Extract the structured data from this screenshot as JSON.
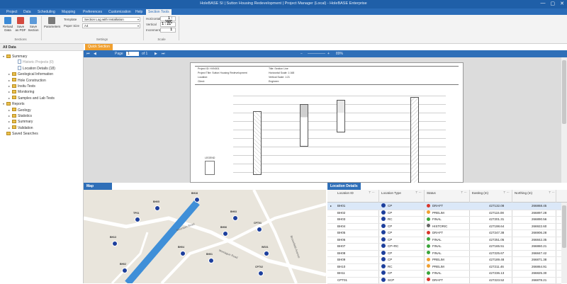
{
  "window": {
    "title": "HoleBASE SI | Sutton Housing Redevelopment | Project Manager (Local) - HoleBASE Enterprise",
    "controls": [
      "—",
      "▢",
      "✕"
    ]
  },
  "ribbon_tabs": [
    "Project",
    "Data",
    "Scheduling",
    "Mapping",
    "Preferences",
    "Customization",
    "Help",
    "Section Tools"
  ],
  "ribbon": {
    "buttons": [
      "Reload Data",
      "Save as PDF",
      "Save Section",
      "Parameters"
    ],
    "group_sections": "Sections",
    "template_label": "Template",
    "template_value": "Section Log with Installation",
    "paper_label": "Paper Size",
    "paper_value": "A4",
    "group_settings": "Settings",
    "horizontal_label": "Horizontal",
    "horizontal_value": "1 : 168*",
    "vertical_label": "Vertical",
    "vertical_value": "1 : 21*",
    "incremental_label": "Incremental",
    "incremental_value": "1",
    "group_scale": "Scale"
  },
  "tree": {
    "header": "All Data",
    "nodes": [
      {
        "label": "Summary",
        "type": "folder",
        "toggle": "▾",
        "level": 0
      },
      {
        "label": "Historic Projects (0)",
        "type": "doc",
        "toggle": "",
        "level": 2,
        "dim": true
      },
      {
        "label": "Location Details (18)",
        "type": "doc",
        "toggle": "",
        "level": 2
      },
      {
        "label": "Geological Information",
        "type": "folder",
        "toggle": "▸",
        "level": 1
      },
      {
        "label": "Hole Construction",
        "type": "folder",
        "toggle": "▸",
        "level": 1
      },
      {
        "label": "Insitu Tests",
        "type": "folder",
        "toggle": "▸",
        "level": 1
      },
      {
        "label": "Monitoring",
        "type": "folder",
        "toggle": "▸",
        "level": 1
      },
      {
        "label": "Samples and Lab Tests",
        "type": "folder",
        "toggle": "▸",
        "level": 1
      },
      {
        "label": "Reports",
        "type": "folder",
        "toggle": "▾",
        "level": 0
      },
      {
        "label": "Geology",
        "type": "folder",
        "toggle": "▸",
        "level": 1
      },
      {
        "label": "Statistics",
        "type": "folder",
        "toggle": "▸",
        "level": 1
      },
      {
        "label": "Summary",
        "type": "folder",
        "toggle": "▸",
        "level": 1
      },
      {
        "label": "Validation",
        "type": "folder",
        "toggle": "▸",
        "level": 1
      },
      {
        "label": "Saved Searches",
        "type": "folder",
        "toggle": "",
        "level": 0
      }
    ]
  },
  "viewer": {
    "tab": "Quick Section",
    "page_label": "Page",
    "page_value": "1",
    "page_of": "of 1",
    "zoom": "89%",
    "zoom_out": "−",
    "zoom_in": "+",
    "nav": [
      "⏮",
      "◀",
      "▶",
      "⏭"
    ],
    "sheet": {
      "project_id": "Project ID: HVN001",
      "project_title": "Project Title: Sutton Housing Redevelopment",
      "location": "Location:",
      "client": "Client:",
      "title": "Title: Section Line",
      "horiz_scale": "Horizontal Scale: 1:168",
      "vert_scale": "Vertical Scale: 1:21",
      "engineer": "Engineer:",
      "legend": "LEGEND"
    }
  },
  "map": {
    "header": "Map",
    "road_labels": [
      "Mountain Road",
      "Montague Road",
      "Broomfield Avenue"
    ],
    "boreholes": [
      "BH18",
      "BH05",
      "BH03",
      "CPT01",
      "BH06",
      "BH04",
      "TP01",
      "BH01",
      "BH02",
      "CPT02",
      "WS01",
      "BH13"
    ]
  },
  "location_details": {
    "header": "Location Details",
    "columns": [
      "Location ID",
      "Location Type",
      "Status",
      "Easting (m)",
      "Northing (m)"
    ],
    "filter_icons": "⊤ ⋯",
    "rows": [
      {
        "id": "BH01",
        "type": "CP",
        "status": "DRAFT",
        "status_color": "#d9352b",
        "easting": "427132.08",
        "northing": "266868.45"
      },
      {
        "id": "BH02",
        "type": "CP",
        "status": "PRELIM",
        "status_color": "#f0a030",
        "easting": "427115.08",
        "northing": "266897.28"
      },
      {
        "id": "BH03",
        "type": "RC",
        "status": "FINAL",
        "status_color": "#3aa53a",
        "easting": "427201.31",
        "northing": "266890.56"
      },
      {
        "id": "BH04",
        "type": "CP",
        "status": "HISTORIC",
        "status_color": "#666666",
        "easting": "427198.64",
        "northing": "266922.60"
      },
      {
        "id": "BH05",
        "type": "CP",
        "status": "DRAFT",
        "status_color": "#d9352b",
        "easting": "427247.38",
        "northing": "266906.28"
      },
      {
        "id": "BH06",
        "type": "CP",
        "status": "FINAL",
        "status_color": "#3aa53a",
        "easting": "427251.05",
        "northing": "266842.35"
      },
      {
        "id": "BH07",
        "type": "CP+RC",
        "status": "FINAL",
        "status_color": "#3aa53a",
        "easting": "427165.51",
        "northing": "266860.21"
      },
      {
        "id": "BH08",
        "type": "CP",
        "status": "FINAL",
        "status_color": "#3aa53a",
        "easting": "427225.67",
        "northing": "266847.42"
      },
      {
        "id": "BH09",
        "type": "CP",
        "status": "PRELIM",
        "status_color": "#f0a030",
        "easting": "427189.48",
        "northing": "266871.38"
      },
      {
        "id": "BH10",
        "type": "RC",
        "status": "PRELIM",
        "status_color": "#f0a030",
        "easting": "427211.46",
        "northing": "266864.91"
      },
      {
        "id": "BH11",
        "type": "CP",
        "status": "FINAL",
        "status_color": "#3aa53a",
        "easting": "427236.13",
        "northing": "266825.30"
      },
      {
        "id": "CPT01",
        "type": "SCP",
        "status": "DRAFT",
        "status_color": "#d9352b",
        "easting": "427223.52",
        "northing": "266878.21"
      }
    ]
  },
  "colors": {
    "titlebar": "#1f5fa8",
    "ribbon_tab_bar": "#2a6cb8",
    "panel_header": "#2f6fb8",
    "doc_tab": "#f0a030",
    "route": "#3f8fd8",
    "pin": "#1d3f9c"
  }
}
